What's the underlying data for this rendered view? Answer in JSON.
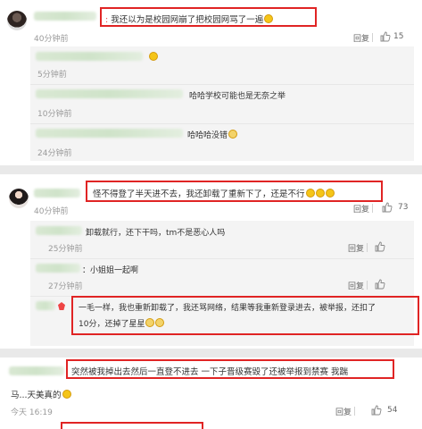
{
  "actions": {
    "reply": "回复"
  },
  "c1": {
    "text": "我还以为是校园网崩了把校园网骂了一遍",
    "time": "40分钟前",
    "likes": "15",
    "replies": [
      {
        "text": "",
        "time": "5分钟前"
      },
      {
        "text": "哈哈学校可能也是无奈之举",
        "time": "10分钟前"
      },
      {
        "text": "哈哈哈没错",
        "time": "24分钟前"
      }
    ]
  },
  "c2": {
    "text": "怪不得登了半天进不去，我还卸载了重新下了，还是不行",
    "time": "40分钟前",
    "likes": "73",
    "replies": [
      {
        "text": "卸载就行，还下干吗，tm不是恶心人吗",
        "time": "25分钟前"
      },
      {
        "text": "：小姐姐一起啊",
        "time": "27分钟前"
      },
      {
        "text_line1": "一毛一样，我也重新卸载了，我还骂网络，结果等我重新登录进去，被举报，还扣了",
        "text_line2": "10分，还掉了星星"
      }
    ]
  },
  "c3": {
    "text_line1": "突然被我掉出去然后一直登不进去 一下子晋级赛毁了还被举报到禁赛 我踹",
    "text_line2": "马...天美真的",
    "time": "今天 16:19",
    "likes": "54"
  }
}
